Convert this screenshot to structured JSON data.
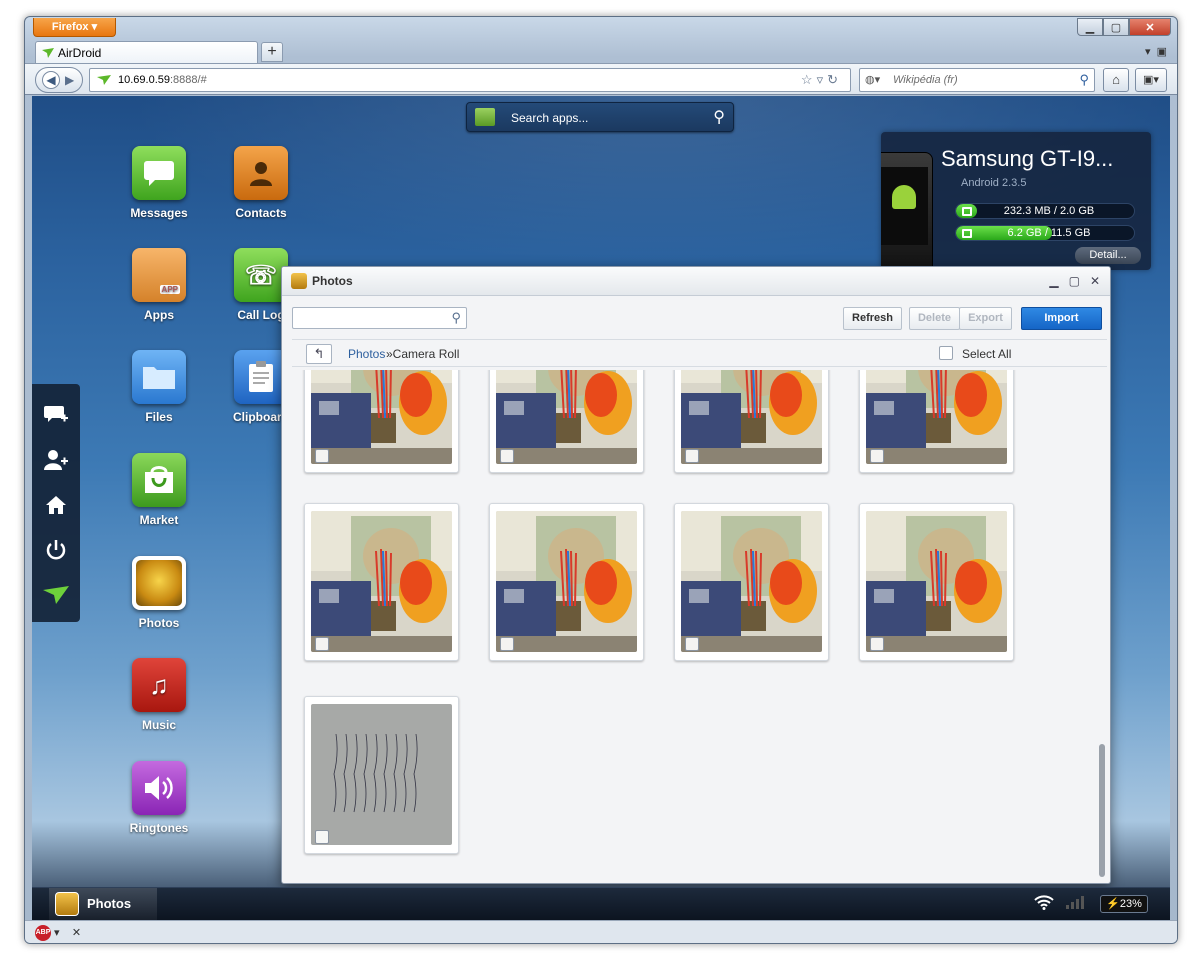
{
  "browser": {
    "menu_button": "Firefox",
    "tab_title": "AirDroid",
    "new_tab": "+",
    "url_host": "10.69.0.59",
    "url_rest": ":8888/#",
    "search_placeholder": "Wikipédia (fr)"
  },
  "airdroid": {
    "app_search_placeholder": "Search apps...",
    "device": {
      "name": "Samsung GT-I9...",
      "android_version": "Android 2.3.5",
      "ram_text": "232.3 MB / 2.0 GB",
      "ram_fraction": 0.12,
      "storage_text": "6.2 GB / 11.5 GB",
      "storage_fraction": 0.54,
      "detail_label": "Detail..."
    },
    "desktop_icons": [
      {
        "label": "Messages",
        "icon": "messages-icon"
      },
      {
        "label": "Contacts",
        "icon": "contacts-icon"
      },
      {
        "label": "Apps",
        "icon": "apps-icon"
      },
      {
        "label": "Call Log",
        "icon": "call-log-icon"
      },
      {
        "label": "Files",
        "icon": "files-icon"
      },
      {
        "label": "Clipboard",
        "icon": "clipboard-icon"
      },
      {
        "label": "Market",
        "icon": "market-icon"
      },
      {
        "label": "Photos",
        "icon": "photos-icon"
      },
      {
        "label": "Music",
        "icon": "music-icon"
      },
      {
        "label": "Ringtones",
        "icon": "ringtones-icon"
      }
    ],
    "dock": [
      "new-message-icon",
      "add-contact-icon",
      "home-icon",
      "power-icon",
      "airdroid-logo-icon"
    ]
  },
  "photos_window": {
    "title": "Photos",
    "buttons": {
      "refresh": "Refresh",
      "delete": "Delete",
      "export": "Export",
      "import": "Import"
    },
    "breadcrumb_root": "Photos",
    "breadcrumb_current": "»Camera Roll",
    "select_all": "Select All",
    "photo_count": 9
  },
  "taskbar": {
    "active_item": "Photos",
    "battery": "23%"
  },
  "statusbar": {
    "abp": "ABP",
    "close": "✕"
  }
}
